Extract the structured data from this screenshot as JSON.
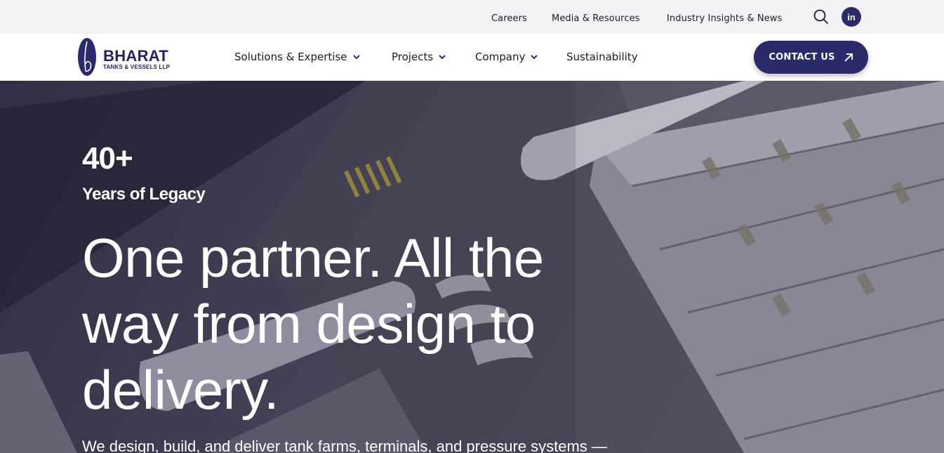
{
  "topbar": {
    "links": [
      "Careers",
      "Media & Resources",
      "Industry Insights & News"
    ],
    "search_icon": "search-icon",
    "linkedin_label": "in"
  },
  "brand": {
    "name": "BHARAT",
    "subname": "TANKS & VESSELS LLP",
    "color": "#2b2a6b"
  },
  "nav": {
    "items": [
      {
        "label": "Solutions & Expertise",
        "has_dropdown": true
      },
      {
        "label": "Projects",
        "has_dropdown": true
      },
      {
        "label": "Company",
        "has_dropdown": true
      },
      {
        "label": "Sustainability",
        "has_dropdown": false
      }
    ],
    "cta_label": "CONTACT US",
    "cta_icon": "arrow-up-right-icon"
  },
  "hero": {
    "stat_value": "40+",
    "stat_label": "Years of Legacy",
    "title": "One partner. All the way from design to delivery.",
    "subtitle": "We design, build, and deliver tank farms, terminals, and pressure systems —"
  }
}
